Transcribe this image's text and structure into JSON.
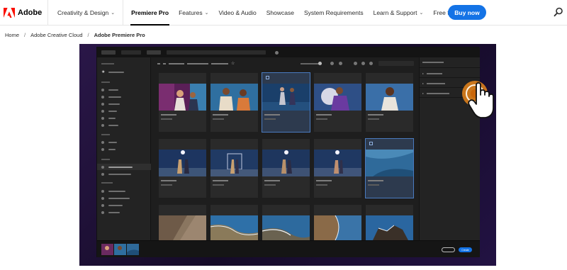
{
  "brand": {
    "name": "Adobe",
    "logo_color": "#fa0f00"
  },
  "nav": {
    "items": [
      {
        "label": "Creativity & Design",
        "has_menu": true
      },
      {
        "label": "Premiere Pro",
        "active": true
      },
      {
        "label": "Features",
        "has_menu": true
      },
      {
        "label": "Video & Audio"
      },
      {
        "label": "Showcase"
      },
      {
        "label": "System Requirements"
      },
      {
        "label": "Learn & Support",
        "has_menu": true
      },
      {
        "label": "Free trial"
      }
    ],
    "buy_label": "Buy now",
    "accent": "#1473e6",
    "search_icon": "search-icon"
  },
  "breadcrumb": [
    "Home",
    "Adobe Creative Cloud",
    "Adobe Premiere Pro"
  ],
  "video_app": {
    "create_label": "Create",
    "highlight_color": "#e8851a"
  }
}
